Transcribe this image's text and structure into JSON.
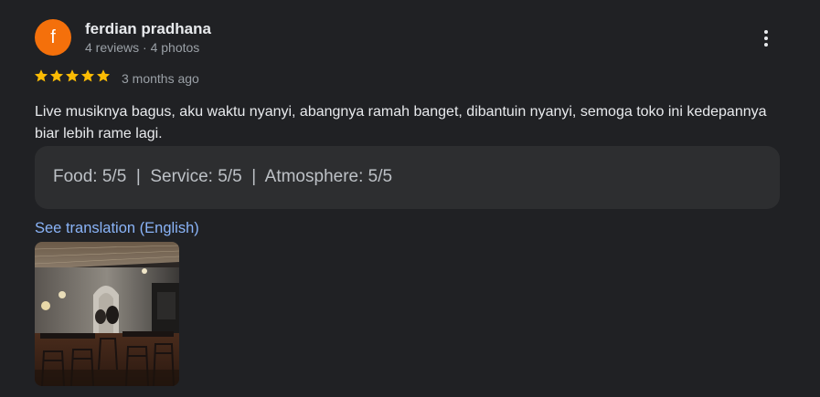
{
  "review": {
    "avatar_letter": "f",
    "avatar_color": "#f4700b",
    "reviewer_name": "ferdian pradhana",
    "reviewer_meta": "4 reviews · 4 photos",
    "rating": 5,
    "rating_max": 5,
    "star_color": "#fbbc04",
    "date": "3 months ago",
    "text": "Live musiknya bagus, aku waktu nyanyi, abangnya ramah banget, dibantuin nyanyi, semoga toko ini kedepannya biar lebih rame lagi.",
    "ratings_summary": "Food: 5/5  |  Service: 5/5  |  Atmosphere: 5/5",
    "translation_link": "See translation (English)",
    "more_icon": "more-vert-icon",
    "photo_alt": "restaurant interior photo"
  }
}
